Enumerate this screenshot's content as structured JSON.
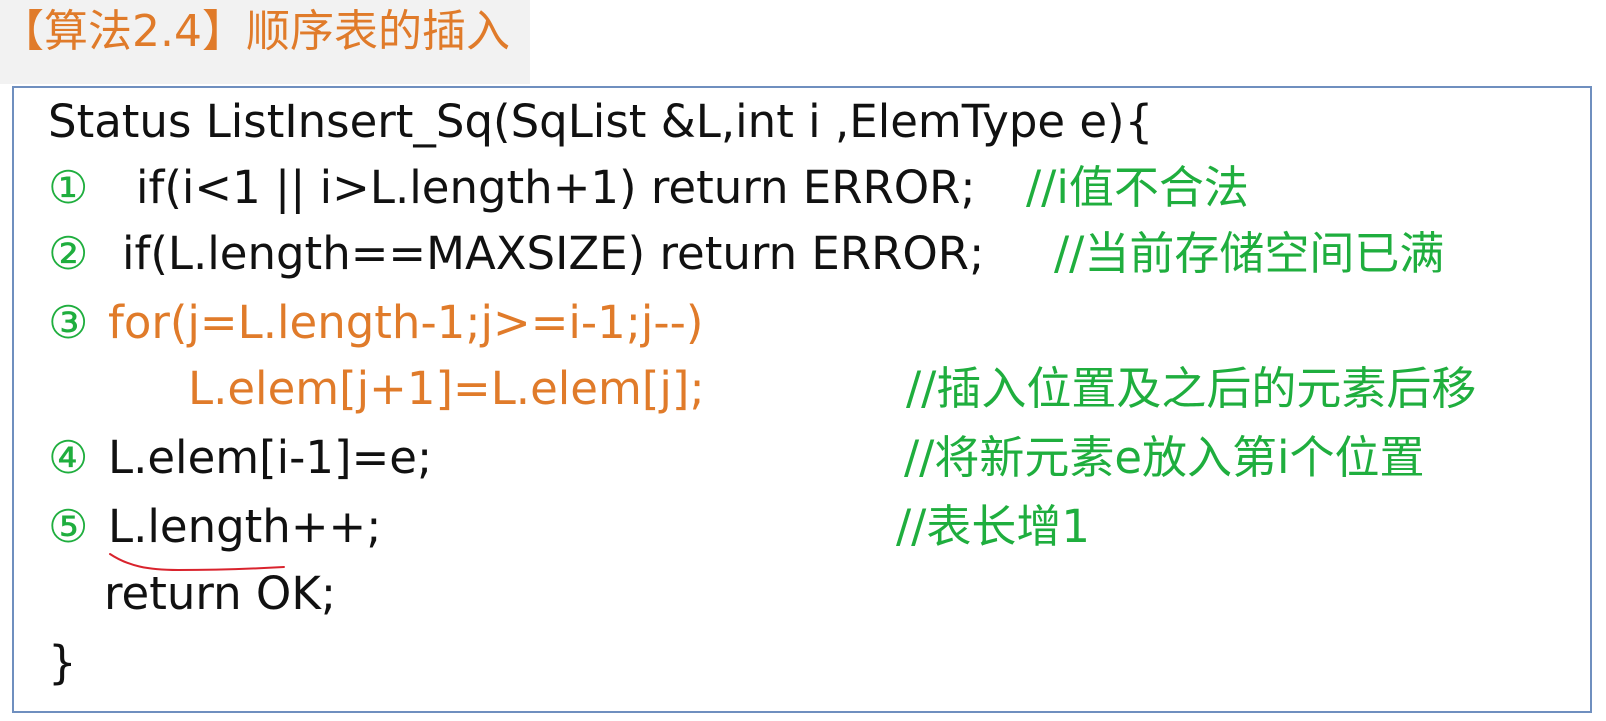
{
  "title": "【算法2.4】顺序表的插入",
  "code": {
    "signature": "Status ListInsert_Sq(SqList &L,int i ,ElemType e){",
    "step1": {
      "num": "①",
      "code": "if(i<1 || i>L.length+1) return ERROR;",
      "comment": "//i值不合法"
    },
    "step2": {
      "num": "②",
      "code": "if(L.length==MAXSIZE) return ERROR;",
      "comment": "//当前存储空间已满"
    },
    "step3": {
      "num": "③",
      "code": "for(j=L.length-1;j>=i-1;j--)"
    },
    "step3_body": {
      "code": "L.elem[j+1]=L.elem[j];",
      "comment": "//插入位置及之后的元素后移"
    },
    "step4": {
      "num": "④",
      "code": "L.elem[i-1]=e;",
      "comment": "//将新元素e放入第i个位置"
    },
    "step5": {
      "num": "⑤",
      "code": "L.length++;",
      "comment": "//表长增1"
    },
    "return_line": "return OK;",
    "closing_brace": "}"
  },
  "colors": {
    "title": "#e07b2a",
    "code": "#111111",
    "step_number": "#1fae3e",
    "comment": "#1fae3e",
    "loop_highlight": "#e07b2a",
    "annotation_underline": "#d9232d",
    "box_border": "#6f8fbf"
  }
}
